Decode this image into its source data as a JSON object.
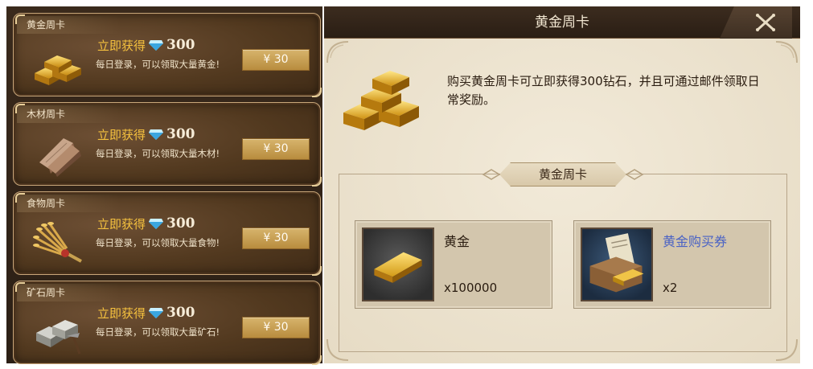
{
  "cards": [
    {
      "title": "黄金周卡",
      "gain_label": "立即获得",
      "gain_value": "300",
      "desc": "每日登录，可以领取大量黄金!",
      "price": "¥ 30",
      "icon": "gold-bars-icon"
    },
    {
      "title": "木材周卡",
      "gain_label": "立即获得",
      "gain_value": "300",
      "desc": "每日登录，可以领取大量木材!",
      "price": "¥ 30",
      "icon": "wood-planks-icon"
    },
    {
      "title": "食物周卡",
      "gain_label": "立即获得",
      "gain_value": "300",
      "desc": "每日登录，可以领取大量食物!",
      "price": "¥ 30",
      "icon": "wheat-icon"
    },
    {
      "title": "矿石周卡",
      "gain_label": "立即获得",
      "gain_value": "300",
      "desc": "每日登录，可以领取大量矿石!",
      "price": "¥ 30",
      "icon": "ore-stones-icon"
    }
  ],
  "detail": {
    "header_title": "黄金周卡",
    "description": "购买黄金周卡可立即获得300钻石，并且可通过邮件领取日常奖励。",
    "section_title": "黄金周卡",
    "rewards": [
      {
        "name": "黄金",
        "qty": "x100000",
        "icon": "gold-ingot-icon",
        "name_color": "#2a1c10"
      },
      {
        "name": "黄金购买券",
        "qty": "x2",
        "icon": "gold-voucher-icon",
        "name_color": "#4b63c4"
      }
    ]
  },
  "colors": {
    "gain_label": "#f5c13e",
    "price_button": "#c9a257",
    "panel_bg": "#ebe1cc"
  }
}
